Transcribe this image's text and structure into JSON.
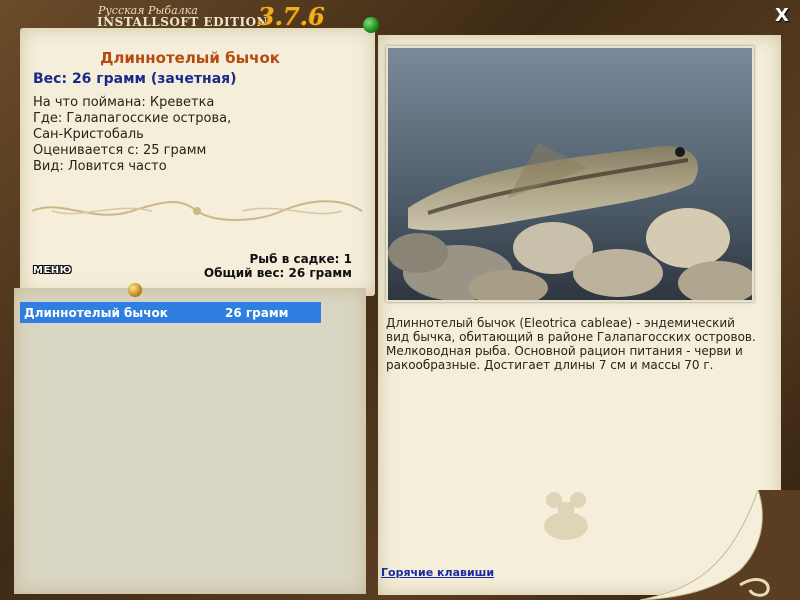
{
  "header": {
    "logo_top": "Русская Рыбалка",
    "logo_main": "INSTALLSOFT EDITION",
    "version": "3.7.6",
    "close_label": "X"
  },
  "fish": {
    "name": "Длиннотелый бычок",
    "weight_line": "Вес: 26 грамм (зачетная)",
    "bait": "На что поймана: Креветка",
    "location_1": "Где: Галапагосские острова,",
    "location_2": "Сан-Кристобаль",
    "rated_from": "Оценивается с: 25 грамм",
    "kind": "Вид: Ловится часто"
  },
  "cage": {
    "count": "Рыб в садке: 1",
    "total_weight": "Общий вес: 26 грамм"
  },
  "menu_label": "МЕНЮ",
  "list": [
    {
      "name": "Длиннотелый бычок",
      "weight": "26 грамм",
      "selected": true
    }
  ],
  "description": "Длиннотелый бычок (Eleotrica cableae) - эндемический вид бычка, обитающий в районе Галапагосских островов. Мелководная рыба. Основной рацион питания - черви и ракообразные. Достигает длины 7 см и массы 70 г.",
  "hotkeys_link": "Горячие клавиши",
  "colors": {
    "title": "#b84a10",
    "weight": "#1a2a8a",
    "selection": "#2f7fe0",
    "link": "#1a2aa0",
    "paper": "#f4eedb",
    "version": "#f0b020"
  }
}
